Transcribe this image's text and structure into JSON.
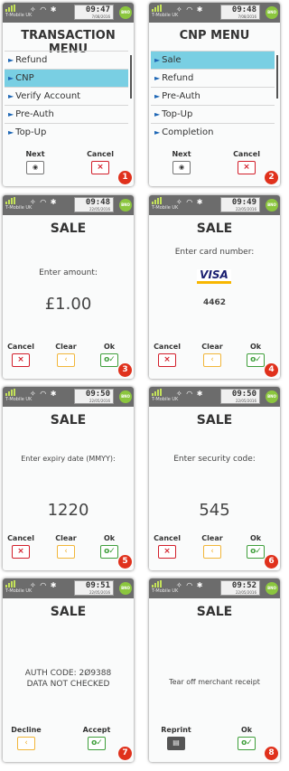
{
  "status_bar": {
    "carrier": "T-Mobile UK",
    "carrier_short": "T-Mobile UK",
    "battery": "BNO",
    "screens": [
      {
        "time": "09:47",
        "date": "7/08/2016"
      },
      {
        "time": "09:48",
        "date": "7/08/2016"
      },
      {
        "time": "09:48",
        "date": "22/05/2016"
      },
      {
        "time": "09:49",
        "date": "22/05/2016"
      },
      {
        "time": "09:50",
        "date": "22/05/2016"
      },
      {
        "time": "09:50",
        "date": "22/05/2016"
      },
      {
        "time": "09:51",
        "date": "22/05/2016"
      },
      {
        "time": "09:52",
        "date": "22/05/2016"
      }
    ]
  },
  "screen1": {
    "title": "TRANSACTION MENU",
    "items": [
      "Refund",
      "CNP",
      "Verify Account",
      "Pre-Auth",
      "Top-Up"
    ],
    "selected": "CNP",
    "next_label": "Next",
    "cancel_label": "Cancel",
    "step": "1"
  },
  "screen2": {
    "title": "CNP MENU",
    "items": [
      "Sale",
      "Refund",
      "Pre-Auth",
      "Top-Up",
      "Completion"
    ],
    "selected": "Sale",
    "next_label": "Next",
    "cancel_label": "Cancel",
    "step": "2"
  },
  "screen3": {
    "title": "SALE",
    "prompt": "Enter amount:",
    "value": "£1.00",
    "cancel_label": "Cancel",
    "clear_label": "Clear",
    "ok_label": "Ok",
    "step": "3"
  },
  "screen4": {
    "title": "SALE",
    "prompt": "Enter card number:",
    "card_brand": "VISA",
    "value": "4462",
    "cancel_label": "Cancel",
    "clear_label": "Clear",
    "ok_label": "Ok",
    "step": "4"
  },
  "screen5": {
    "title": "SALE",
    "prompt": "Enter expiry date (MMYY):",
    "value": "1220",
    "cancel_label": "Cancel",
    "clear_label": "Clear",
    "ok_label": "Ok",
    "step": "5"
  },
  "screen6": {
    "title": "SALE",
    "prompt": "Enter security code:",
    "value": "545",
    "cancel_label": "Cancel",
    "clear_label": "Clear",
    "ok_label": "Ok",
    "step": "6"
  },
  "screen7": {
    "title": "SALE",
    "line1": "AUTH CODE: 2Ø9388",
    "line2": "DATA NOT CHECKED",
    "decline_label": "Decline",
    "accept_label": "Accept",
    "step": "7"
  },
  "screen8": {
    "title": "SALE",
    "prompt": "Tear off merchant receipt",
    "reprint_label": "Reprint",
    "ok_label": "Ok",
    "step": "8"
  },
  "keys": {
    "cancel": "×",
    "clear": "‹",
    "ok": "o✓",
    "next": "◉",
    "reprint": "▤"
  },
  "colors": {
    "selected": "#79cfe3",
    "cancel": "#d21f2b",
    "clear": "#f1b63a",
    "ok": "#3f9f3b",
    "badge": "#e0311c"
  }
}
